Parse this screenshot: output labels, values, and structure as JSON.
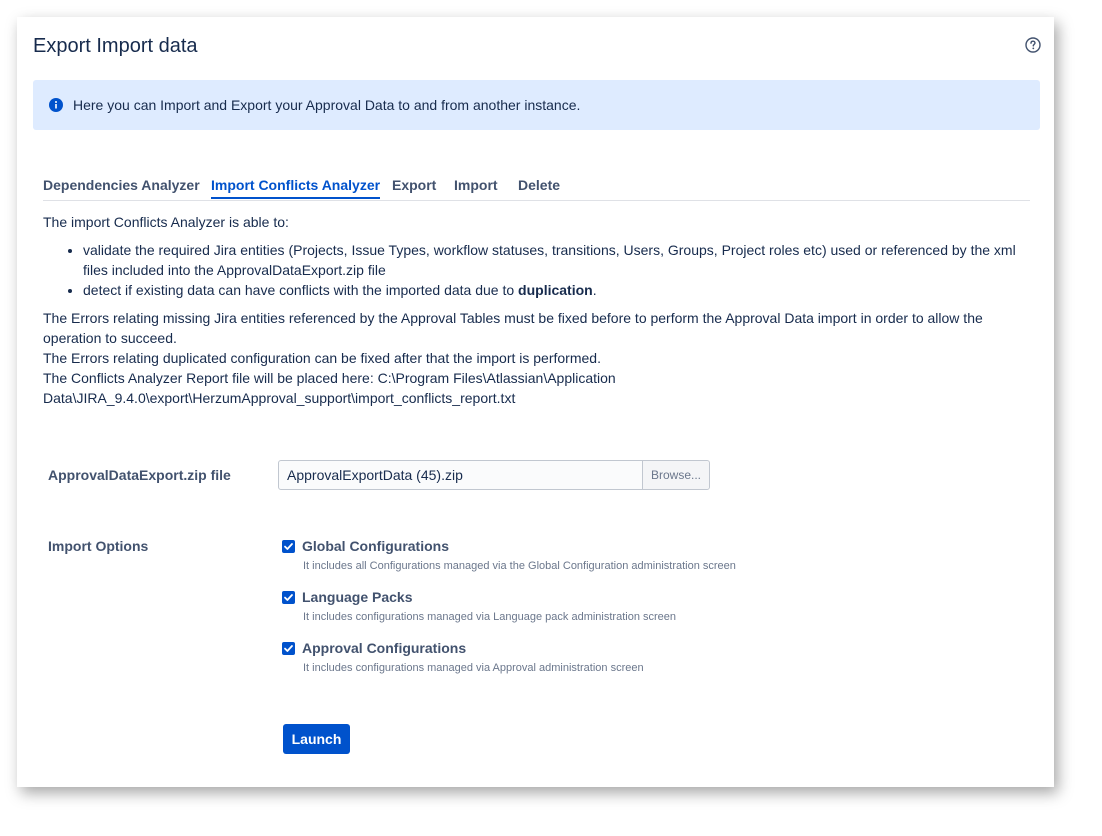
{
  "header": {
    "title": "Export Import data",
    "help_icon": "help-circle-icon"
  },
  "info": {
    "icon": "info-icon",
    "text": "Here you can Import and Export your Approval Data to and from another instance."
  },
  "tabs": [
    {
      "label": "Dependencies Analyzer",
      "active": false
    },
    {
      "label": "Import Conflicts Analyzer",
      "active": true
    },
    {
      "label": "Export",
      "active": false
    },
    {
      "label": "Import",
      "active": false
    },
    {
      "label": "Delete",
      "active": false
    }
  ],
  "content": {
    "intro": "The import Conflicts Analyzer is able to:",
    "bullets": [
      "validate the required Jira entities (Projects, Issue Types, workflow statuses, transitions, Users, Groups, Project roles etc) used or referenced by the xml files included into the ApprovalDataExport.zip file",
      "detect if existing data can have conflicts with the imported data due to "
    ],
    "bullet2_bold": "duplication",
    "bullet2_end": ".",
    "para1": "The Errors relating missing Jira entities referenced by the Approval Tables must be fixed before to perform the Approval Data import in order to allow the operation to succeed.",
    "para2": "The Errors relating duplicated configuration can be fixed after that the import is performed.",
    "para3": "The Conflicts Analyzer Report file will be placed here: C:\\Program Files\\Atlassian\\Application Data\\JIRA_9.4.0\\export\\HerzumApproval_support\\import_conflicts_report.txt"
  },
  "form": {
    "file_label": "ApprovalDataExport.zip file",
    "file_value": "ApprovalExportData (45).zip",
    "browse_label": "Browse...",
    "options_label": "Import Options",
    "options": [
      {
        "title": "Global Configurations",
        "desc": "It includes all Configurations managed via the Global Configuration administration screen",
        "checked": true
      },
      {
        "title": "Language Packs",
        "desc": "It includes configurations managed via Language pack administration screen",
        "checked": true
      },
      {
        "title": "Approval Configurations",
        "desc": "It includes configurations managed via Approval administration screen",
        "checked": true
      }
    ],
    "launch_label": "Launch"
  },
  "colors": {
    "accent": "#0052cc",
    "info_bg": "#deebff"
  }
}
